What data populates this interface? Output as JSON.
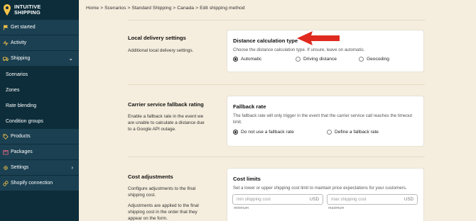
{
  "brand": {
    "line1": "INTUITIVE",
    "line2": "SHIPPING",
    "accent": "#f6c34a"
  },
  "sidebar": {
    "items": [
      {
        "label": "Get started",
        "icon": "flag-icon"
      },
      {
        "label": "Activity",
        "icon": "activity-icon"
      },
      {
        "label": "Shipping",
        "icon": "truck-icon"
      },
      {
        "label": "Scenarios"
      },
      {
        "label": "Zones"
      },
      {
        "label": "Rate blending"
      },
      {
        "label": "Condition groups"
      },
      {
        "label": "Products",
        "icon": "tag-icon"
      },
      {
        "label": "Packages",
        "icon": "package-icon"
      },
      {
        "label": "Settings",
        "icon": "gear-icon"
      },
      {
        "label": "Shopify connection",
        "icon": "link-icon"
      }
    ]
  },
  "breadcrumb": [
    "Home",
    "Scenarios",
    "Standard Shipping",
    "Canada",
    "Edit shipping method"
  ],
  "sections": {
    "local": {
      "title": "Local delivery settings",
      "desc": "Additional local delivery settings.",
      "card_title": "Distance calculation type",
      "card_text": "Choose the distance calculation type. If unsure, leave on automatic.",
      "options": [
        "Automatic",
        "Driving distance",
        "Geocoding"
      ],
      "selected": 0
    },
    "fallback": {
      "title": "Carrier service fallback rating",
      "desc": "Enable a fallback rate in the event we are unable to calculate a distance due to a Google API outage.",
      "card_title": "Fallback rate",
      "card_text": "The fallback rate will only trigger in the event that the carrier service call reaches the timeout limit.",
      "options": [
        "Do not use a fallback rate",
        "Define a fallback rate"
      ],
      "selected": 0
    },
    "cost": {
      "title": "Cost adjustments",
      "desc1": "Configure adjustments to the final shipping cost.",
      "desc2": "Adjustments are applied to the final shipping cost in the order that they appear on the form.",
      "card_title": "Cost limits",
      "card_text": "Set a lower or upper shipping cost limit to maintain price expectations for your customers.",
      "min_placeholder": "min shipping cost",
      "max_placeholder": "max shipping cost",
      "currency": "USD",
      "min_hint": "minimum",
      "max_hint": "maximum"
    }
  },
  "colors": {
    "sidebar": "#0d2d3a",
    "page": "#f5eddd",
    "arrow": "#e02a1f"
  }
}
